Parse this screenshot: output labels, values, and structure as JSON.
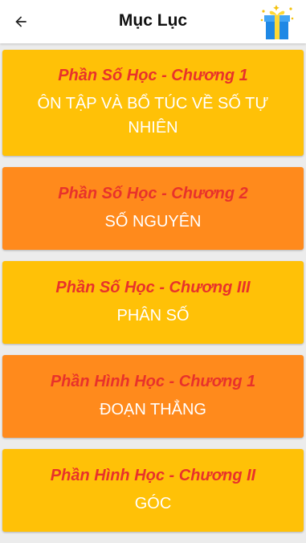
{
  "appbar": {
    "title": "Mục Lục",
    "back_icon": "arrow-left-icon",
    "gift_icon": "gift-box-icon"
  },
  "colors": {
    "yellow_card": "#ffc107",
    "orange_card": "#ff8a1c",
    "section_text": "#e8322b",
    "title_text": "#ffffff"
  },
  "chapters": [
    {
      "section": "Phần Số Học - Chương 1",
      "title": "ÔN TẬP VÀ BỔ TÚC VỀ SỐ TỰ NHIÊN",
      "color": "yellow"
    },
    {
      "section": "Phần Số Học - Chương 2",
      "title": "SỐ NGUYÊN",
      "color": "orange"
    },
    {
      "section": "Phần Số Học - Chương III",
      "title": "PHÂN SỐ",
      "color": "yellow"
    },
    {
      "section": "Phần Hình Học - Chương 1",
      "title": "ĐOẠN THẲNG",
      "color": "orange"
    },
    {
      "section": "Phần Hình Học - Chương II",
      "title": "GÓC",
      "color": "yellow"
    }
  ]
}
